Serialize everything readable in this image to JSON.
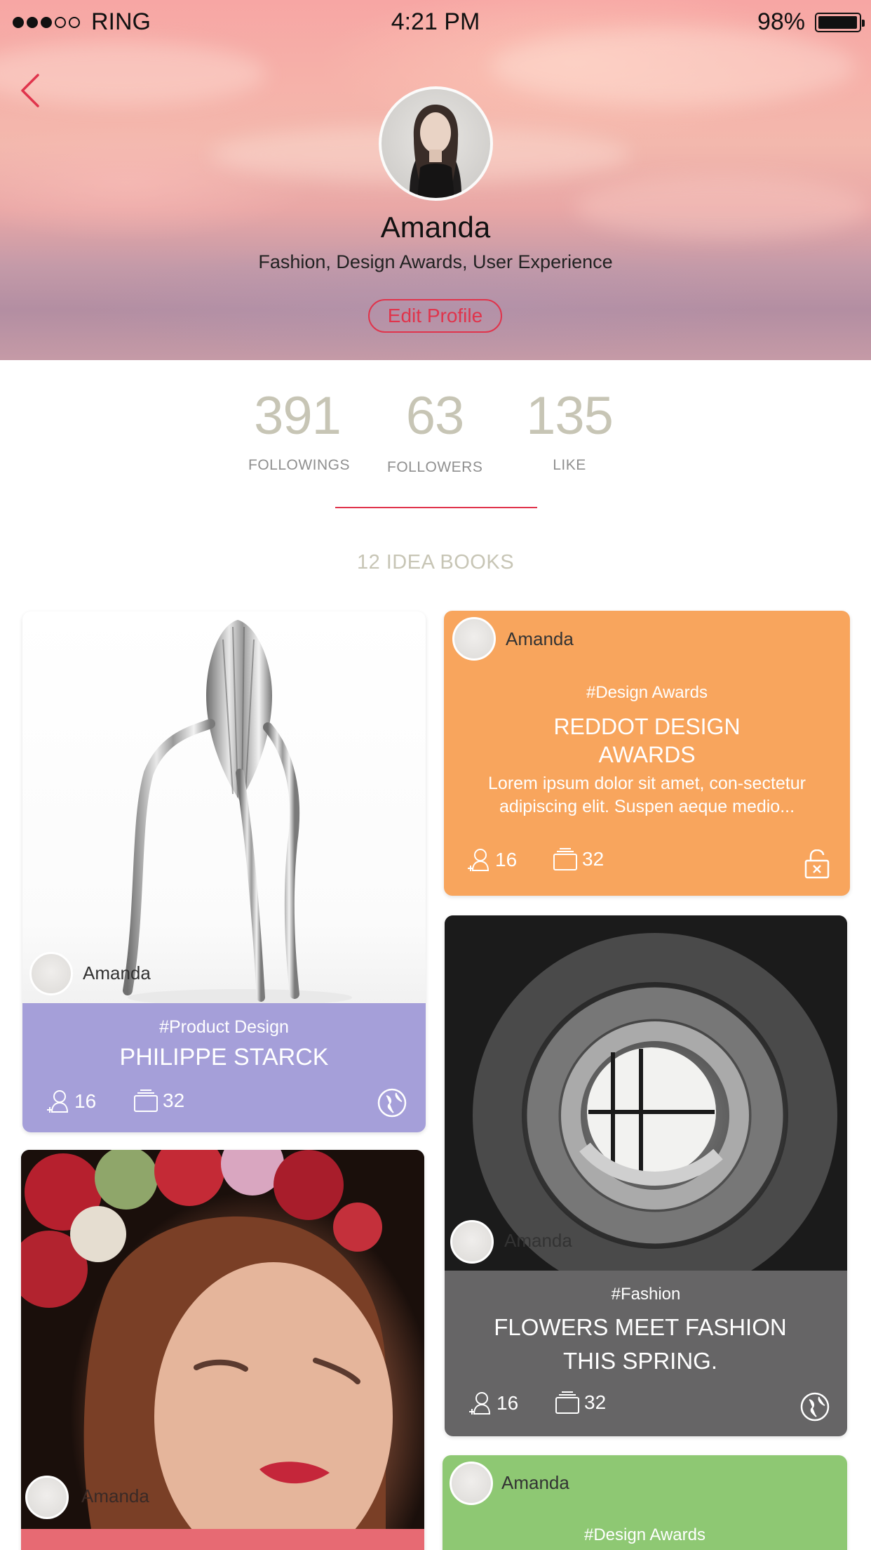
{
  "status_bar": {
    "carrier": "RING",
    "time": "4:21 PM",
    "battery": "98%",
    "battery_level": 0.98,
    "signal_bars_full": 3,
    "signal_bars_total": 5
  },
  "header": {
    "name": "Amanda",
    "tags": "Fashion, Design Awards, User Experience",
    "edit_button": "Edit Profile"
  },
  "stats": [
    {
      "value": "391",
      "label": "FOLLOWINGS"
    },
    {
      "value": "63",
      "label": "FOLLOWERS"
    },
    {
      "value": "135",
      "label": "LIKE"
    }
  ],
  "books_count": "12 IDEA BOOKS",
  "cards": {
    "philippe": {
      "author": "Amanda",
      "tag": "#Product Design",
      "title": "PHILIPPE STARCK",
      "followers": "16",
      "items": "32",
      "color": "#a59fd9"
    },
    "reddot": {
      "author": "Amanda",
      "tag": "#Design Awards",
      "title_line1": "REDDOT DESIGN",
      "title_line2": "AWARDS",
      "desc_line1": "Lorem ipsum dolor sit amet, con-sectetur",
      "desc_line2": "adipiscing elit. Suspen aeque medio...",
      "followers": "16",
      "items": "32",
      "color": "#f8a55d"
    },
    "flowers": {
      "author": "Amanda",
      "tag": "#Fashion",
      "title_line1": "FLOWERS MEET FASHION",
      "title_line2": "THIS SPRING.",
      "followers": "16",
      "items": "32",
      "color": "#666566"
    },
    "portrait": {
      "author": "Amanda",
      "color": "#e76a73"
    },
    "green": {
      "author": "Amanda",
      "tag": "#Design Awards",
      "color": "#8ec873"
    }
  },
  "icons": {
    "back": "chevron-left-icon",
    "followers": "add-user-icon",
    "items": "stack-icon",
    "public": "globe-icon",
    "private": "unlock-icon"
  },
  "colors": {
    "accent": "#e0344c",
    "stat_number": "#c7c5b5"
  }
}
